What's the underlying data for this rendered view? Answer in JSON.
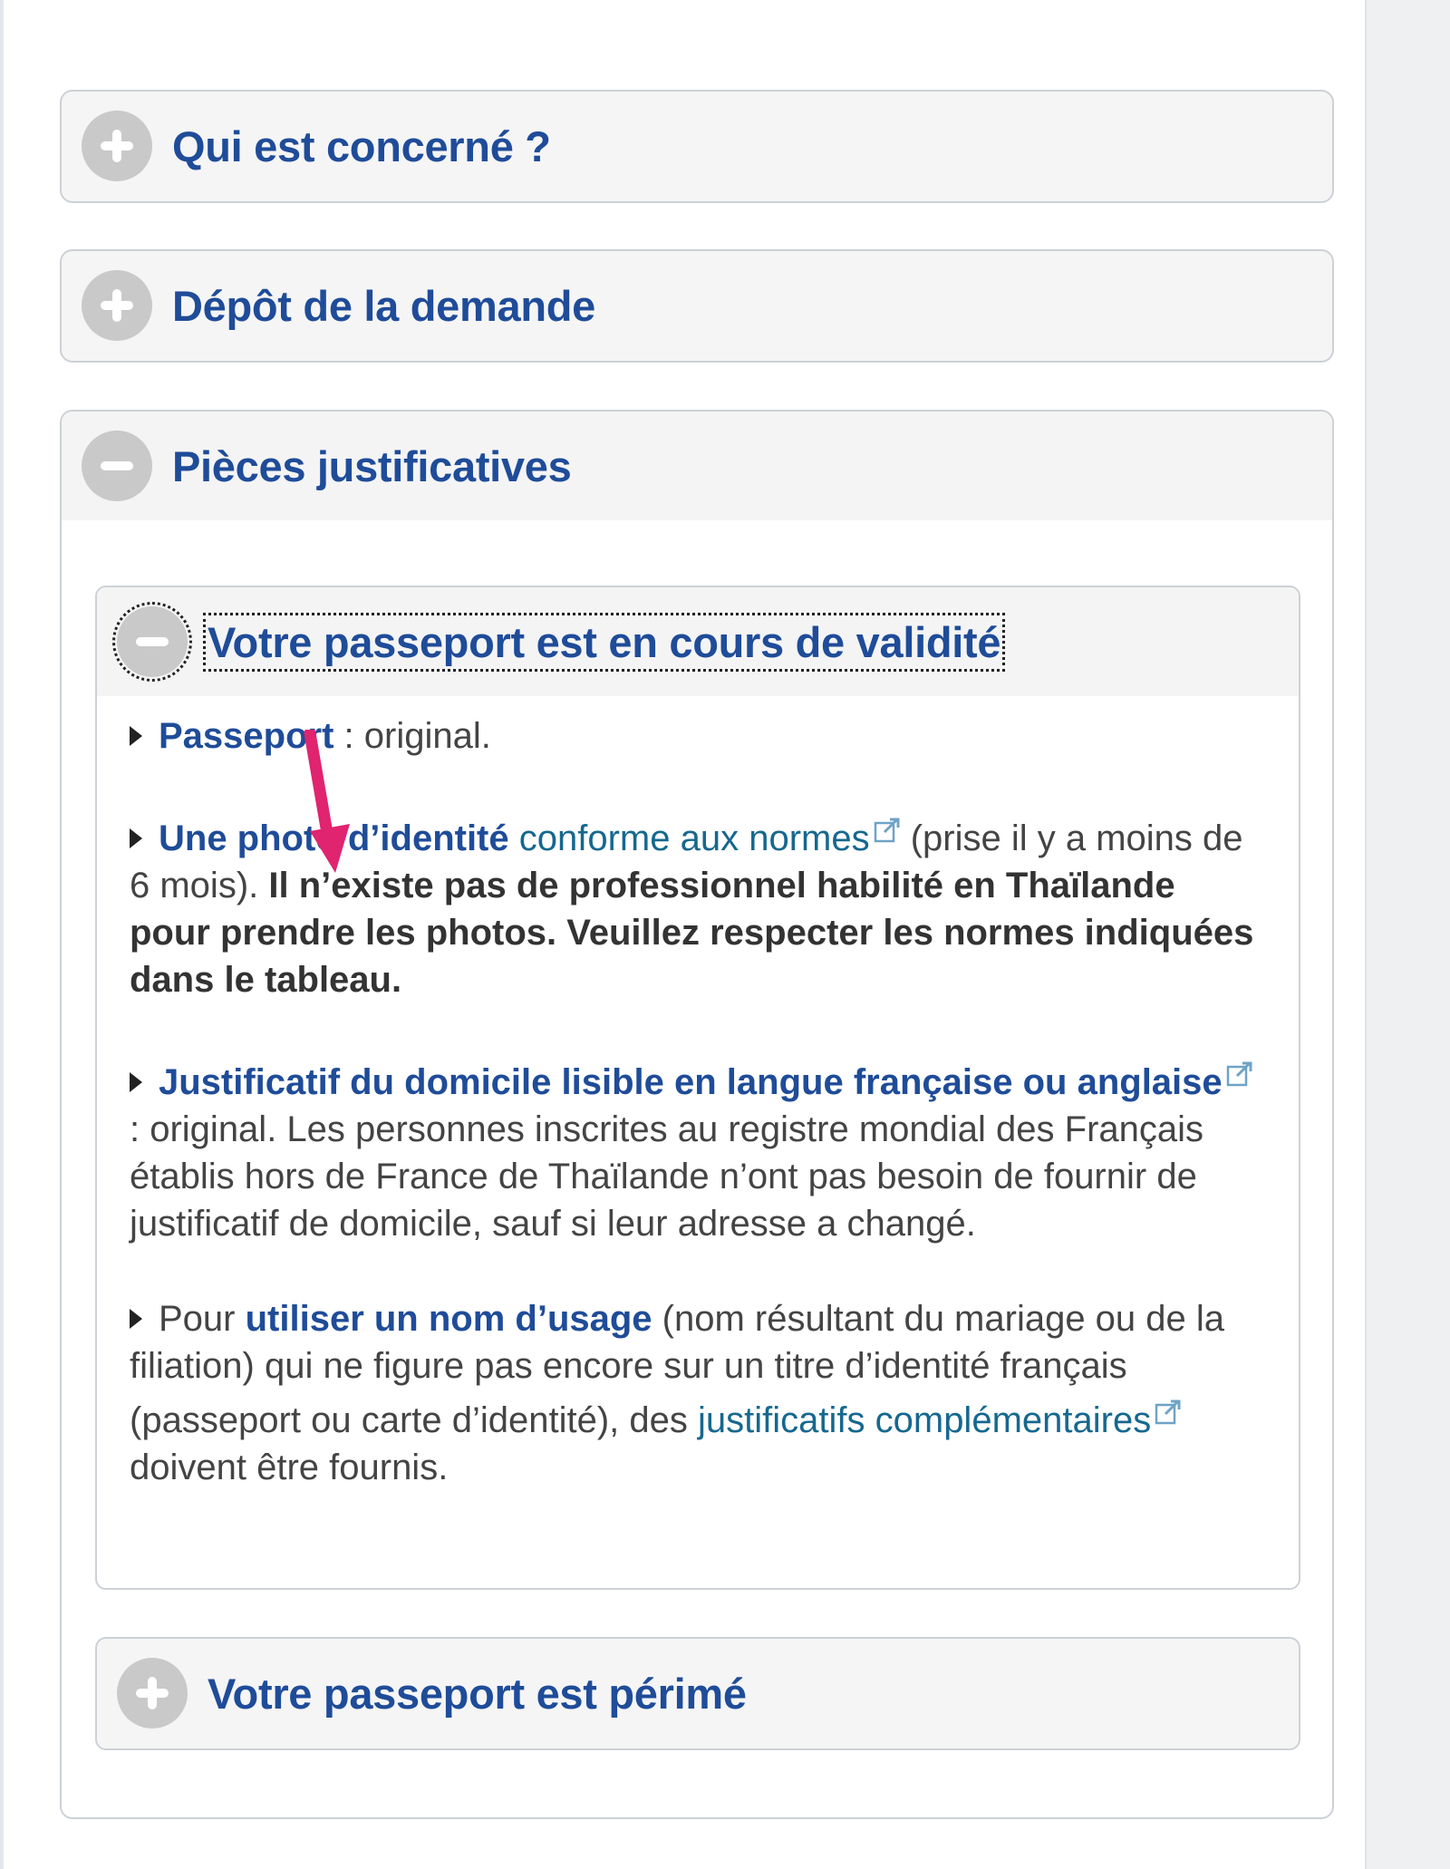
{
  "colors": {
    "heading": "#1f4c99",
    "link": "#16688f",
    "text": "#444444",
    "arrow": "#e0246f",
    "icon_bg": "#c9c9c9"
  },
  "accordions": [
    {
      "title": "Qui est concerné ?",
      "state": "collapsed",
      "icon": "plus-icon"
    },
    {
      "title": "Dépôt de la demande",
      "state": "collapsed",
      "icon": "plus-icon"
    },
    {
      "title": "Pièces justificatives",
      "state": "expanded",
      "icon": "minus-icon"
    }
  ],
  "sub_sections": {
    "valid": {
      "title": "Votre passeport est en cours de validité",
      "state": "expanded",
      "icon": "minus-icon"
    },
    "expired": {
      "title": "Votre passeport est périmé",
      "state": "collapsed",
      "icon": "plus-icon"
    }
  },
  "items": {
    "passport": {
      "label": "Passeport",
      "rest": " : original."
    },
    "photo": {
      "label": "Une photo d’identité",
      "link": "conforme aux normes",
      "after_link": " (prise il y a moins de 6 mois). ",
      "bold_note": "Il n’existe pas de professionnel habilité en Thaïlande pour prendre les photos. Veuillez respecter les normes indiquées dans le tableau."
    },
    "domicile": {
      "label": "Justificatif du domicile lisible en langue française ou anglaise",
      "rest": " : original. Les personnes inscrites au registre mondial des Français établis hors de France de Thaïlande n’ont pas besoin de fournir de justificatif de domicile, sauf si leur adresse a changé."
    },
    "usage": {
      "prefix": "Pour ",
      "label": "utiliser un nom d’usage",
      "middle": " (nom résultant du mariage ou de la filiation) qui ne figure pas encore sur un titre d’identité français (passeport ou carte d’identité), des ",
      "link": "justificatifs complémentaires",
      "suffix": " doivent être fournis."
    }
  },
  "annotation": {
    "icon": "arrow-down-icon"
  }
}
